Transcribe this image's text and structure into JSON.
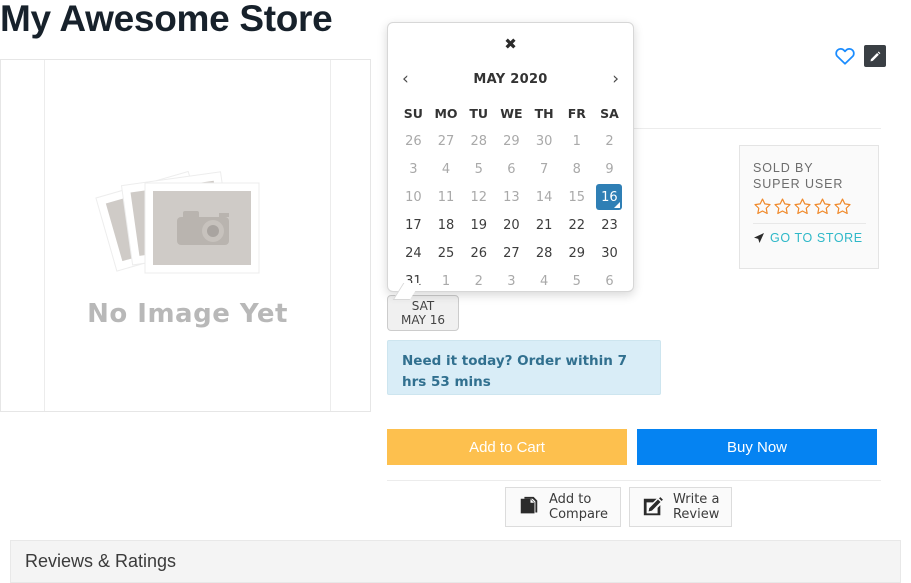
{
  "store": {
    "title": "My Awesome Store"
  },
  "gallery": {
    "placeholder_text": "No Image Yet",
    "placeholder_icon": "camera-photos-icon"
  },
  "actions": {
    "wishlist_icon": "heart-icon",
    "edit_icon": "pencil-icon"
  },
  "sold_by": {
    "label": "SOLD BY",
    "seller": "SUPER USER",
    "rating": 0,
    "max_rating": 5,
    "star_color": "#f0892a",
    "store_link": "GO TO STORE",
    "store_link_icon": "navigation-arrow-icon",
    "store_link_color": "#2eb8c8"
  },
  "delivery": {
    "chip_day": "SAT",
    "chip_date": "MAY 16",
    "alert_text": "Need it today? Order within 7 hrs 53 mins",
    "alert_bg": "#d9edf7",
    "alert_color": "#31708f"
  },
  "buttons": {
    "add_to_cart": "Add to Cart",
    "add_to_cart_color": "#fdc04e",
    "buy_now": "Buy Now",
    "buy_now_color": "#0583f2",
    "add_to_compare": "Add to\nCompare",
    "add_to_compare_line1": "Add to",
    "add_to_compare_line2": "Compare",
    "add_to_compare_icon": "copy-pages-icon",
    "write_review_line1": "Write a",
    "write_review_line2": "Review",
    "write_review_icon": "pencil-square-icon"
  },
  "reviews_section": {
    "title": "Reviews & Ratings"
  },
  "calendar": {
    "close_label": "✖",
    "prev_label": "‹",
    "next_label": "›",
    "month_title": "MAY 2020",
    "selected_day": 16,
    "selected_color": "#2f7fb5",
    "weekdays": [
      "SU",
      "MO",
      "TU",
      "WE",
      "TH",
      "FR",
      "SA"
    ],
    "weeks": [
      [
        {
          "d": "26",
          "muted": true
        },
        {
          "d": "27",
          "muted": true
        },
        {
          "d": "28",
          "muted": true
        },
        {
          "d": "29",
          "muted": true
        },
        {
          "d": "30",
          "muted": true
        },
        {
          "d": "1",
          "muted": true
        },
        {
          "d": "2",
          "muted": true
        }
      ],
      [
        {
          "d": "3",
          "muted": true
        },
        {
          "d": "4",
          "muted": true
        },
        {
          "d": "5",
          "muted": true
        },
        {
          "d": "6",
          "muted": true
        },
        {
          "d": "7",
          "muted": true
        },
        {
          "d": "8",
          "muted": true
        },
        {
          "d": "9",
          "muted": true
        }
      ],
      [
        {
          "d": "10",
          "muted": true
        },
        {
          "d": "11",
          "muted": true
        },
        {
          "d": "12",
          "muted": true
        },
        {
          "d": "13",
          "muted": true
        },
        {
          "d": "14",
          "muted": true
        },
        {
          "d": "15",
          "muted": true
        },
        {
          "d": "16",
          "muted": false,
          "selected": true
        }
      ],
      [
        {
          "d": "17",
          "muted": false
        },
        {
          "d": "18",
          "muted": false
        },
        {
          "d": "19",
          "muted": false
        },
        {
          "d": "20",
          "muted": false
        },
        {
          "d": "21",
          "muted": false
        },
        {
          "d": "22",
          "muted": false
        },
        {
          "d": "23",
          "muted": false
        }
      ],
      [
        {
          "d": "24",
          "muted": false
        },
        {
          "d": "25",
          "muted": false
        },
        {
          "d": "26",
          "muted": false
        },
        {
          "d": "27",
          "muted": false
        },
        {
          "d": "28",
          "muted": false
        },
        {
          "d": "29",
          "muted": false
        },
        {
          "d": "30",
          "muted": false
        }
      ],
      [
        {
          "d": "31",
          "muted": false
        },
        {
          "d": "1",
          "muted": true
        },
        {
          "d": "2",
          "muted": true
        },
        {
          "d": "3",
          "muted": true
        },
        {
          "d": "4",
          "muted": true
        },
        {
          "d": "5",
          "muted": true
        },
        {
          "d": "6",
          "muted": true
        }
      ]
    ]
  }
}
